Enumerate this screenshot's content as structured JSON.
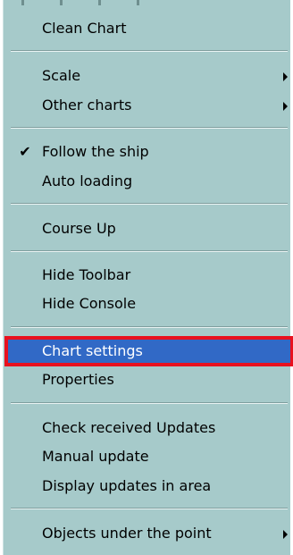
{
  "menu": {
    "items": [
      {
        "label": "Clean Chart"
      },
      {
        "label": "Scale"
      },
      {
        "label": "Other charts"
      },
      {
        "label": "Follow the ship",
        "checked": true
      },
      {
        "label": "Auto loading"
      },
      {
        "label": "Course Up"
      },
      {
        "label": "Hide Toolbar"
      },
      {
        "label": "Hide Console"
      },
      {
        "label": "Chart settings",
        "highlighted": true
      },
      {
        "label": "Properties"
      },
      {
        "label": "Check received Updates"
      },
      {
        "label": "Manual update"
      },
      {
        "label": "Display updates in area"
      },
      {
        "label": "Objects under the point"
      }
    ],
    "check_glyph": "✔",
    "colors": {
      "menu_background": "#a6caca",
      "highlight_background": "#3169c6",
      "highlight_text": "#ffffff",
      "annotation_frame": "#e8111f"
    }
  }
}
